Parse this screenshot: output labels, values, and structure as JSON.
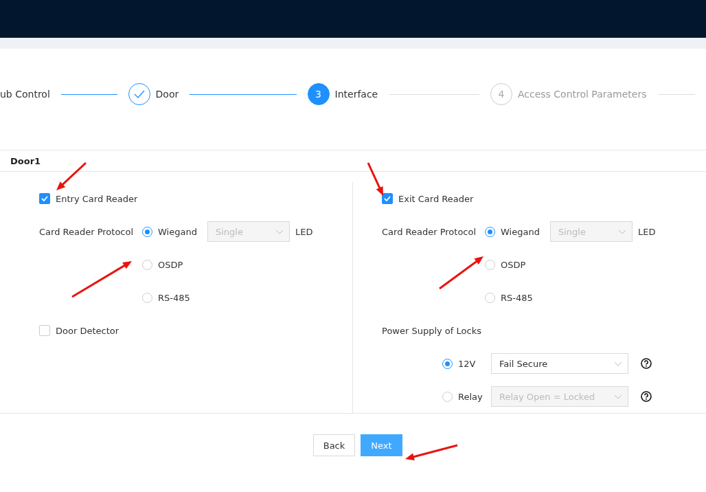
{
  "steps": [
    {
      "label": "ub Control",
      "kind": "done"
    },
    {
      "label": "Door",
      "kind": "done"
    },
    {
      "label": "Interface",
      "kind": "active",
      "number": "3"
    },
    {
      "label": "Access Control Parameters",
      "kind": "pending",
      "number": "4"
    }
  ],
  "section": {
    "title": "Door1"
  },
  "readers": [
    {
      "label": "Entry Card Reader",
      "checked": true,
      "protocol_label": "Card Reader Protocol",
      "protocols": [
        {
          "label": "Wiegand",
          "selected": true
        },
        {
          "label": "OSDP",
          "selected": false
        },
        {
          "label": "RS-485",
          "selected": false
        }
      ],
      "mode_select": {
        "value": "Single",
        "disabled": true
      },
      "led_label": "LED"
    },
    {
      "label": "Exit Card Reader",
      "checked": true,
      "protocol_label": "Card Reader Protocol",
      "protocols": [
        {
          "label": "Wiegand",
          "selected": true
        },
        {
          "label": "OSDP",
          "selected": false
        },
        {
          "label": "RS-485",
          "selected": false
        }
      ],
      "mode_select": {
        "value": "Single",
        "disabled": true
      },
      "led_label": "LED"
    }
  ],
  "door_detector": {
    "label": "Door Detector",
    "checked": false
  },
  "power_supply": {
    "label": "Power Supply of Locks",
    "options": [
      {
        "label": "12V",
        "selected": true,
        "select": {
          "value": "Fail Secure",
          "disabled": false
        }
      },
      {
        "label": "Relay",
        "selected": false,
        "select": {
          "value": "Relay Open = Locked",
          "disabled": true
        }
      }
    ]
  },
  "buttons": [
    {
      "label": "Back",
      "kind": "default"
    },
    {
      "label": "Next",
      "kind": "primary"
    }
  ]
}
